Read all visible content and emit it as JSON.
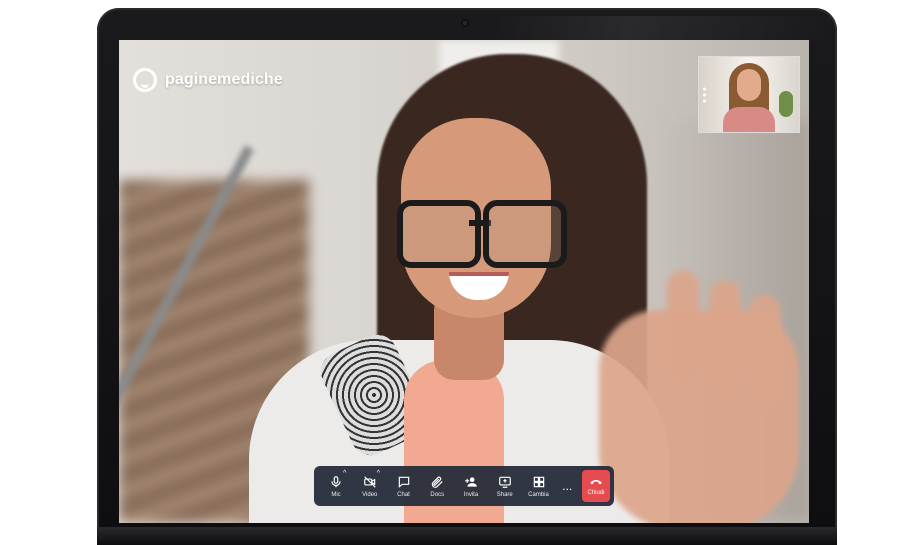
{
  "app": {
    "logo_text": "paginemediche"
  },
  "toolbar": {
    "mic_label": "Mic",
    "video_label": "Video",
    "chat_label": "Chat",
    "docs_label": "Docs",
    "invite_label": "Invita",
    "share_label": "Share",
    "switch_label": "Cambia",
    "more_label": "...",
    "close_label": "Chiudi"
  },
  "colors": {
    "toolbar_bg": "#262c3a",
    "close_button": "#e54b4f",
    "text": "#ffffff"
  },
  "icons": {
    "mic": "microphone-icon",
    "video": "video-off-icon",
    "chat": "chat-bubble-icon",
    "docs": "paperclip-icon",
    "invite": "add-person-icon",
    "share": "screen-share-icon",
    "switch": "grid-layout-icon",
    "close": "hang-up-phone-icon"
  }
}
